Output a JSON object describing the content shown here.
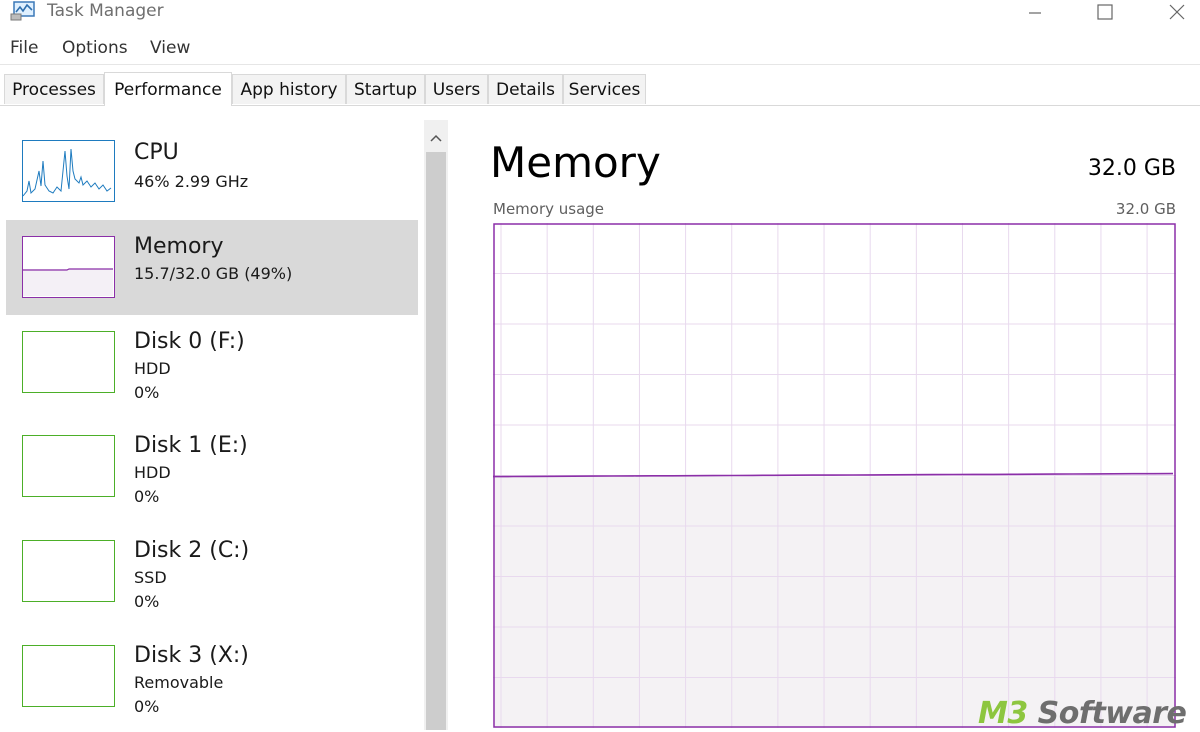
{
  "window": {
    "title": "Task Manager",
    "controls": [
      "minimize",
      "maximize",
      "close"
    ]
  },
  "menu": [
    "File",
    "Options",
    "View"
  ],
  "tabs": [
    {
      "label": "Processes"
    },
    {
      "label": "Performance",
      "active": true
    },
    {
      "label": "App history"
    },
    {
      "label": "Startup"
    },
    {
      "label": "Users"
    },
    {
      "label": "Details"
    },
    {
      "label": "Services"
    }
  ],
  "sidebar": {
    "items": [
      {
        "name": "CPU",
        "line1": "46%  2.99 GHz",
        "line2": "",
        "color": "#1e7bbf"
      },
      {
        "name": "Memory",
        "line1": "15.7/32.0 GB (49%)",
        "line2": "",
        "color": "#8b2fa8",
        "selected": true
      },
      {
        "name": "Disk 0 (F:)",
        "line1": "HDD",
        "line2": "0%",
        "color": "#4caf28"
      },
      {
        "name": "Disk 1 (E:)",
        "line1": "HDD",
        "line2": "0%",
        "color": "#4caf28"
      },
      {
        "name": "Disk 2 (C:)",
        "line1": "SSD",
        "line2": "0%",
        "color": "#4caf28"
      },
      {
        "name": "Disk 3 (X:)",
        "line1": "Removable",
        "line2": "0%",
        "color": "#4caf28"
      }
    ]
  },
  "detail": {
    "title": "Memory",
    "total": "32.0 GB",
    "graph_label": "Memory usage",
    "graph_max": "32.0 GB",
    "usage_fraction": 0.49,
    "accent": "#8b2fa8",
    "fill": "#f4f2f4",
    "grid": "#e8d9ee"
  },
  "watermark": {
    "prefix": "M3",
    "suffix": " Software",
    "prefix_color": "#8dc63f",
    "suffix_color": "#6e6e6e"
  }
}
